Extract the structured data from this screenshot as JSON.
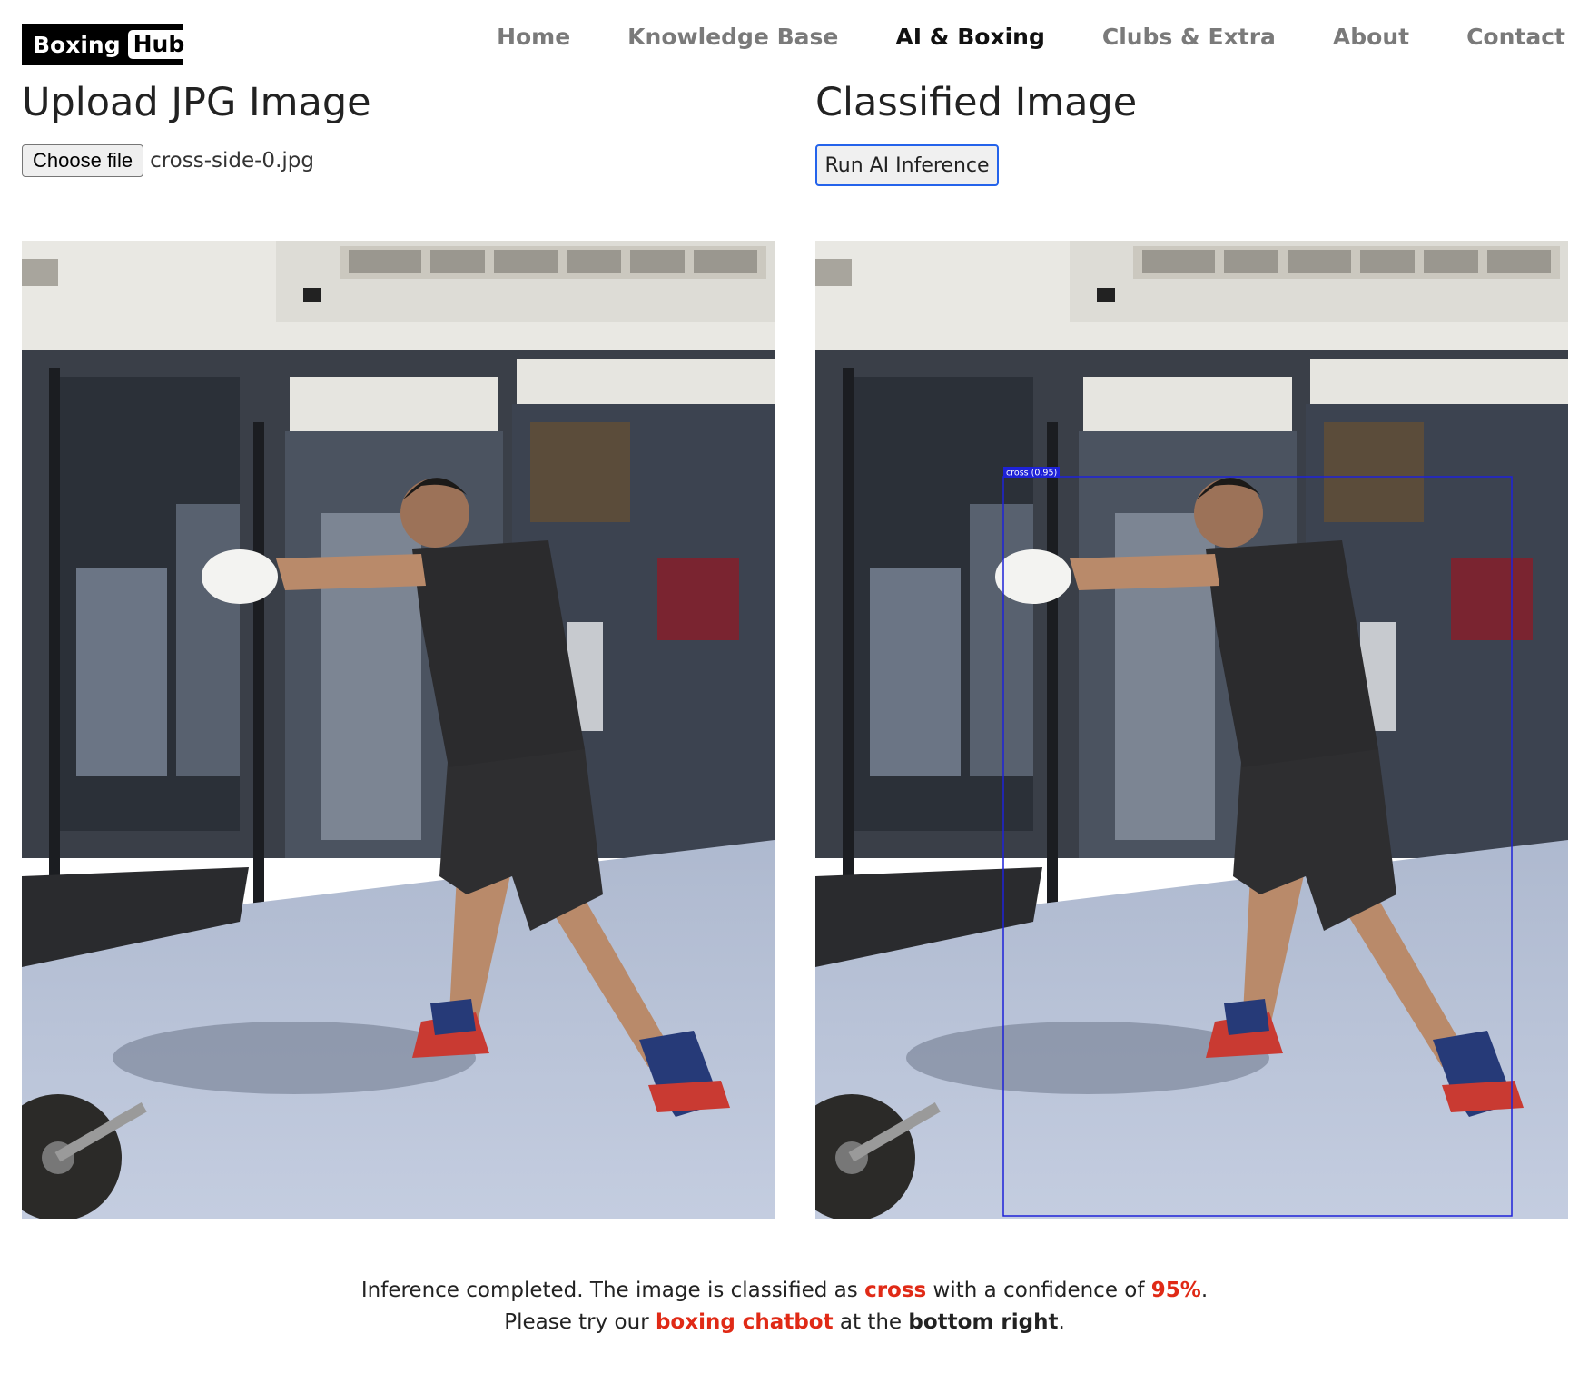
{
  "header": {
    "logo_word1": "Boxing",
    "logo_word2": "Hub",
    "nav": [
      {
        "label": "Home",
        "active": false
      },
      {
        "label": "Knowledge Base",
        "active": false
      },
      {
        "label": "AI & Boxing",
        "active": true
      },
      {
        "label": "Clubs & Extra",
        "active": false
      },
      {
        "label": "About",
        "active": false
      },
      {
        "label": "Contact",
        "active": false
      }
    ]
  },
  "upload": {
    "title": "Upload JPG Image",
    "choose_button": "Choose file",
    "file_name": "cross-side-0.jpg"
  },
  "classified": {
    "title": "Classified Image",
    "run_button": "Run AI Inference",
    "detection_label": "cross (0.95)"
  },
  "result": {
    "line1_prefix": "Inference completed. The image is classified as ",
    "class_name": "cross",
    "line1_mid": " with a confidence of ",
    "confidence": "95%",
    "line1_suffix": ".",
    "line2_prefix": "Please try our ",
    "chatbot_link": "boxing chatbot",
    "line2_mid": " at the ",
    "location": "bottom right",
    "line2_suffix": "."
  },
  "colors": {
    "accent_red": "#e02a16",
    "button_focus_blue": "#2463eb",
    "bbox_blue": "#1e22d8",
    "nav_inactive": "#7a7a7a"
  }
}
